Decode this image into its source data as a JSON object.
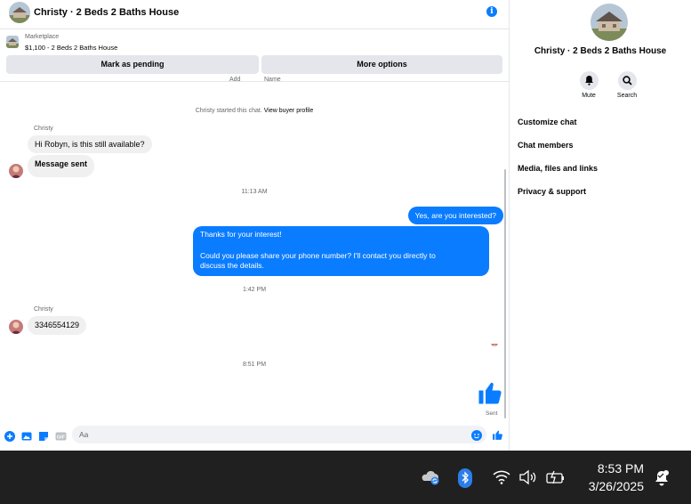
{
  "header": {
    "title": "Christy · 2 Beds 2 Baths House",
    "info_icon": "info-icon"
  },
  "marketplace": {
    "label": "Marketplace",
    "listing": "$1,100 - 2 Beds 2 Baths House",
    "mark_pending_label": "Mark as pending",
    "more_options_label": "More options",
    "cut_label_1": "Add",
    "cut_label_2": "Name"
  },
  "thread": {
    "started_text": "Christy started this chat.",
    "view_profile_link": "View buyer profile",
    "sender_name_1": "Christy",
    "msg_in_1": "Hi Robyn, is this still available?",
    "msg_in_2": "Message sent",
    "time_1": "11:13 AM",
    "msg_out_1": "Yes, are you interested?",
    "msg_out_2_line1": "Thanks for your interest!",
    "msg_out_2_line2": "Could you please share your phone number? I'll contact you directly to",
    "msg_out_2_line3": "discuss the details.",
    "time_2": "1:42 PM",
    "sender_name_2": "Christy",
    "msg_in_3": "3346554129",
    "time_3": "8:51 PM",
    "sent_label": "Sent"
  },
  "composer": {
    "placeholder": "Aa"
  },
  "side": {
    "title": "Christy · 2 Beds 2 Baths House",
    "mute_label": "Mute",
    "search_label": "Search",
    "items": [
      "Customize chat",
      "Chat members",
      "Media, files and links",
      "Privacy & support"
    ]
  },
  "taskbar": {
    "time": "8:53 PM",
    "date": "3/26/2025"
  },
  "colors": {
    "accent": "#0a7cff",
    "bubble_in": "#f0f0f0",
    "taskbar": "#202020"
  }
}
